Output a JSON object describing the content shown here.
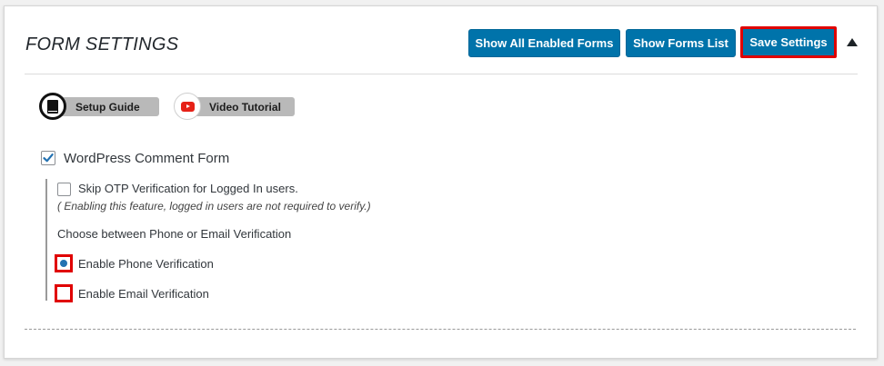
{
  "header": {
    "title": "FORM SETTINGS",
    "show_enabled_label": "Show All Enabled Forms",
    "show_list_label": "Show Forms List",
    "save_label": "Save Settings"
  },
  "guides": {
    "setup_label": "Setup Guide",
    "video_label": "Video Tutorial"
  },
  "form": {
    "name": "WordPress Comment Form",
    "checked": true,
    "skip_otp_label": "Skip OTP Verification for Logged In users.",
    "skip_otp_checked": false,
    "skip_otp_note": "( Enabling this feature, logged in users are not required to verify.)",
    "choose_text": "Choose between Phone or Email Verification",
    "phone_label": "Enable Phone Verification",
    "email_label": "Enable Email Verification",
    "selected": "phone"
  },
  "colors": {
    "button": "#0073aa",
    "highlight": "#e00000",
    "radio": "#2271b1"
  },
  "icons": {
    "setup": "book-icon",
    "video": "youtube-icon",
    "collapse": "triangle-up-icon"
  }
}
